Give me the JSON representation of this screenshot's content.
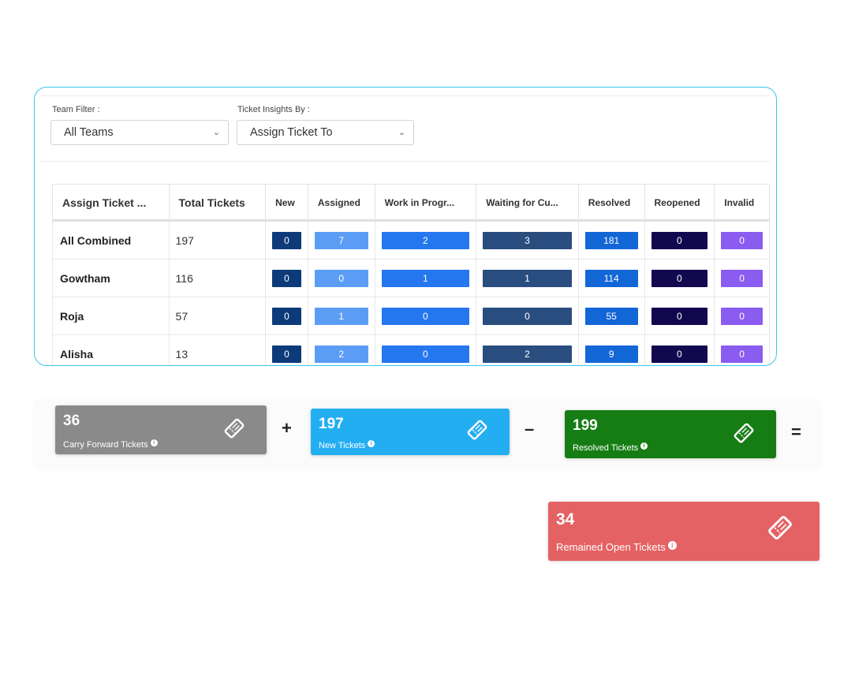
{
  "filters": {
    "team_label": "Team Filter :",
    "team_value": "All Teams",
    "insights_label": "Ticket Insights By :",
    "insights_value": "Assign Ticket To"
  },
  "table": {
    "headers": [
      "Assign Ticket ...",
      "Total Tickets",
      "New",
      "Assigned",
      "Work in Progr...",
      "Waiting for Cu...",
      "Resolved",
      "Reopened",
      "Invalid"
    ],
    "rows": [
      {
        "name": "All Combined",
        "total": "197",
        "values": [
          "0",
          "7",
          "2",
          "3",
          "181",
          "0",
          "0"
        ]
      },
      {
        "name": "Gowtham",
        "total": "116",
        "values": [
          "0",
          "0",
          "1",
          "1",
          "114",
          "0",
          "0"
        ]
      },
      {
        "name": "Roja",
        "total": "57",
        "values": [
          "0",
          "1",
          "0",
          "0",
          "55",
          "0",
          "0"
        ]
      },
      {
        "name": "Alisha",
        "total": "13",
        "values": [
          "0",
          "2",
          "0",
          "2",
          "9",
          "0",
          "0"
        ]
      }
    ],
    "status_colors": [
      "#0d3b7a",
      "#5b9df5",
      "#2477ee",
      "#2a4d7f",
      "#1366d6",
      "#12084f",
      "#8a5cf0"
    ]
  },
  "summary": {
    "carry_forward": {
      "value": "36",
      "label": "Carry Forward Tickets",
      "color": "#8a8a8a",
      "icon": "ticket-icon"
    },
    "op_plus": "+",
    "new": {
      "value": "197",
      "label": "New Tickets",
      "color": "#23aef2",
      "icon": "ticket-icon"
    },
    "op_minus": "–",
    "resolved": {
      "value": "199",
      "label": "Resolved Tickets",
      "color": "#157d14",
      "icon": "ticket-icon"
    },
    "op_equals": "=",
    "remained": {
      "value": "34",
      "label": "Remained Open Tickets",
      "color": "#e46264",
      "icon": "ticket-icon"
    },
    "info_glyph": "i"
  }
}
